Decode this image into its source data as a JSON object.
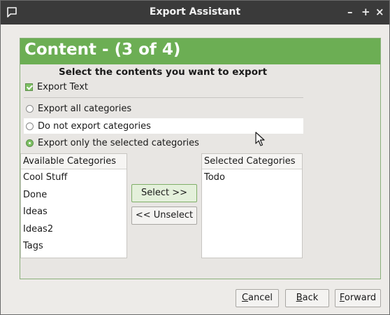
{
  "window": {
    "title": "Export Assistant",
    "controls": {
      "minimize": "–",
      "maximize": "+",
      "close": "×"
    }
  },
  "header": {
    "banner": "Content - (3 of 4)",
    "subtitle": "Select the contents you want to export"
  },
  "export_text": {
    "label": "Export Text",
    "checked": true
  },
  "category_options": [
    {
      "label": "Export all categories",
      "selected": false
    },
    {
      "label": "Do not export categories",
      "selected": false
    },
    {
      "label": "Export only the selected categories",
      "selected": true
    }
  ],
  "available": {
    "header": "Available Categories",
    "items": [
      "Cool Stuff",
      "Done",
      "Ideas",
      "Ideas2",
      "Tags"
    ]
  },
  "selected": {
    "header": "Selected Categories",
    "items": [
      "Todo"
    ]
  },
  "transfer": {
    "select_label": "Select >>",
    "unselect_label": "<< Unselect"
  },
  "footer": {
    "cancel": {
      "mnemonic": "C",
      "rest": "ancel"
    },
    "back": {
      "mnemonic": "B",
      "rest": "ack"
    },
    "forward": {
      "mnemonic": "F",
      "rest": "orward"
    }
  },
  "colors": {
    "accent": "#6cae54",
    "titlebar": "#3a3a3a",
    "background": "#edebe8"
  }
}
